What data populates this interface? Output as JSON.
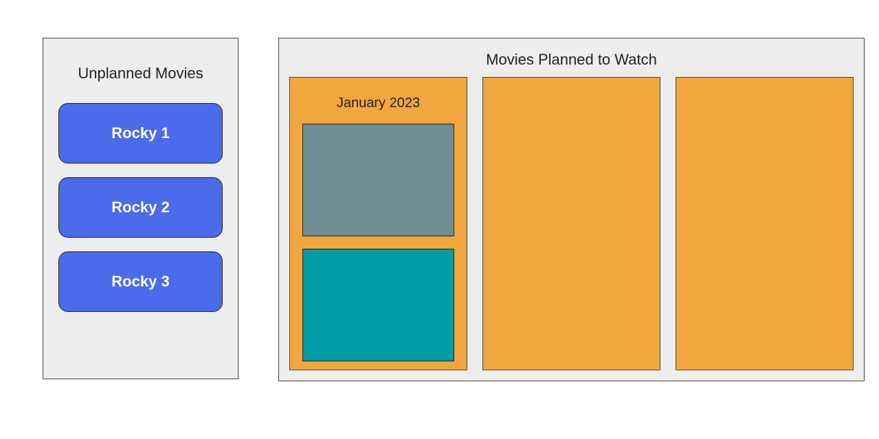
{
  "unplanned": {
    "title": "Unplanned Movies",
    "items": [
      {
        "label": "Rocky 1"
      },
      {
        "label": "Rocky 2"
      },
      {
        "label": "Rocky 3"
      }
    ]
  },
  "planned": {
    "title": "Movies Planned to Watch",
    "months": [
      {
        "label": "January 2023"
      },
      {
        "label": ""
      },
      {
        "label": ""
      }
    ]
  }
}
